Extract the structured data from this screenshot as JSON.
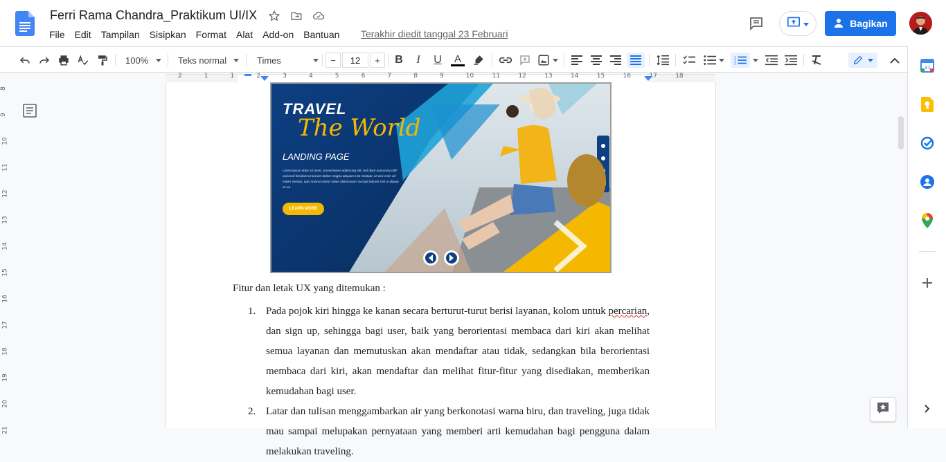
{
  "document": {
    "title": "Ferri Rama Chandra_Praktikum UI/IX",
    "last_edit": "Terakhir diedit tanggal 23 Februari"
  },
  "menu": [
    "File",
    "Edit",
    "Tampilan",
    "Sisipkan",
    "Format",
    "Alat",
    "Add-on",
    "Bantuan"
  ],
  "header": {
    "share_label": "Bagikan"
  },
  "toolbar": {
    "zoom": "100%",
    "style": "Teks normal",
    "font": "Times",
    "font_size": "12",
    "minus": "−",
    "plus": "+"
  },
  "ruler": {
    "h_marks": [
      "2",
      "1",
      "1",
      "2",
      "3",
      "4",
      "5",
      "6",
      "7",
      "8",
      "9",
      "10",
      "11",
      "12",
      "13",
      "14",
      "15",
      "16",
      "17",
      "18"
    ],
    "v_marks": [
      "8",
      "9",
      "10",
      "11",
      "12",
      "13",
      "14",
      "15",
      "16",
      "17",
      "18",
      "19",
      "20",
      "21"
    ]
  },
  "hero_image": {
    "headline": "TRAVEL",
    "script": "The World",
    "subtitle": "LANDING PAGE",
    "body": "Lorem ipsum dolor sit amet, consectetuer adipiscing elit, sed diam nonummy nibh euismod tincidunt ut laoreet dolore magna aliquam erat volutpat. Ut wisi enim ad minim veniam, quis nostrud exerci tation ullamcorper suscipit lobortis nisl ut aliquip ex ea",
    "cta": "LEARN MORE",
    "colors": {
      "navy": "#0a3a78",
      "accent_yellow": "#f5b800",
      "cyan": "#1fa3d8",
      "sweater": "#f2b418"
    }
  },
  "body": {
    "intro": "Fitur dan letak UX yang ditemukan :",
    "items": [
      {
        "num": "1.",
        "pre": "Pada pojok kiri hingga ke kanan secara berturut-turut berisi layanan, kolom untuk ",
        "squiggle": "percarian",
        "post": ", dan sign up, sehingga bagi user, baik yang berorientasi membaca dari kiri akan melihat semua layanan dan memutuskan akan mendaftar atau tidak, sedangkan bila berorientasi membaca dari kiri, akan mendaftar dan melihat fitur-fitur yang disediakan, memberikan kemudahan bagi user."
      },
      {
        "num": "2.",
        "text": "Latar dan tulisan menggambarkan air yang berkonotasi warna biru, dan traveling, juga tidak mau sampai melupakan pernyataan yang memberi arti kemudahan bagi pengguna dalam melakukan traveling."
      }
    ]
  },
  "colors": {
    "accent": "#1a73e8",
    "docs_blue": "#4285f4",
    "squiggle": "#d93025"
  }
}
